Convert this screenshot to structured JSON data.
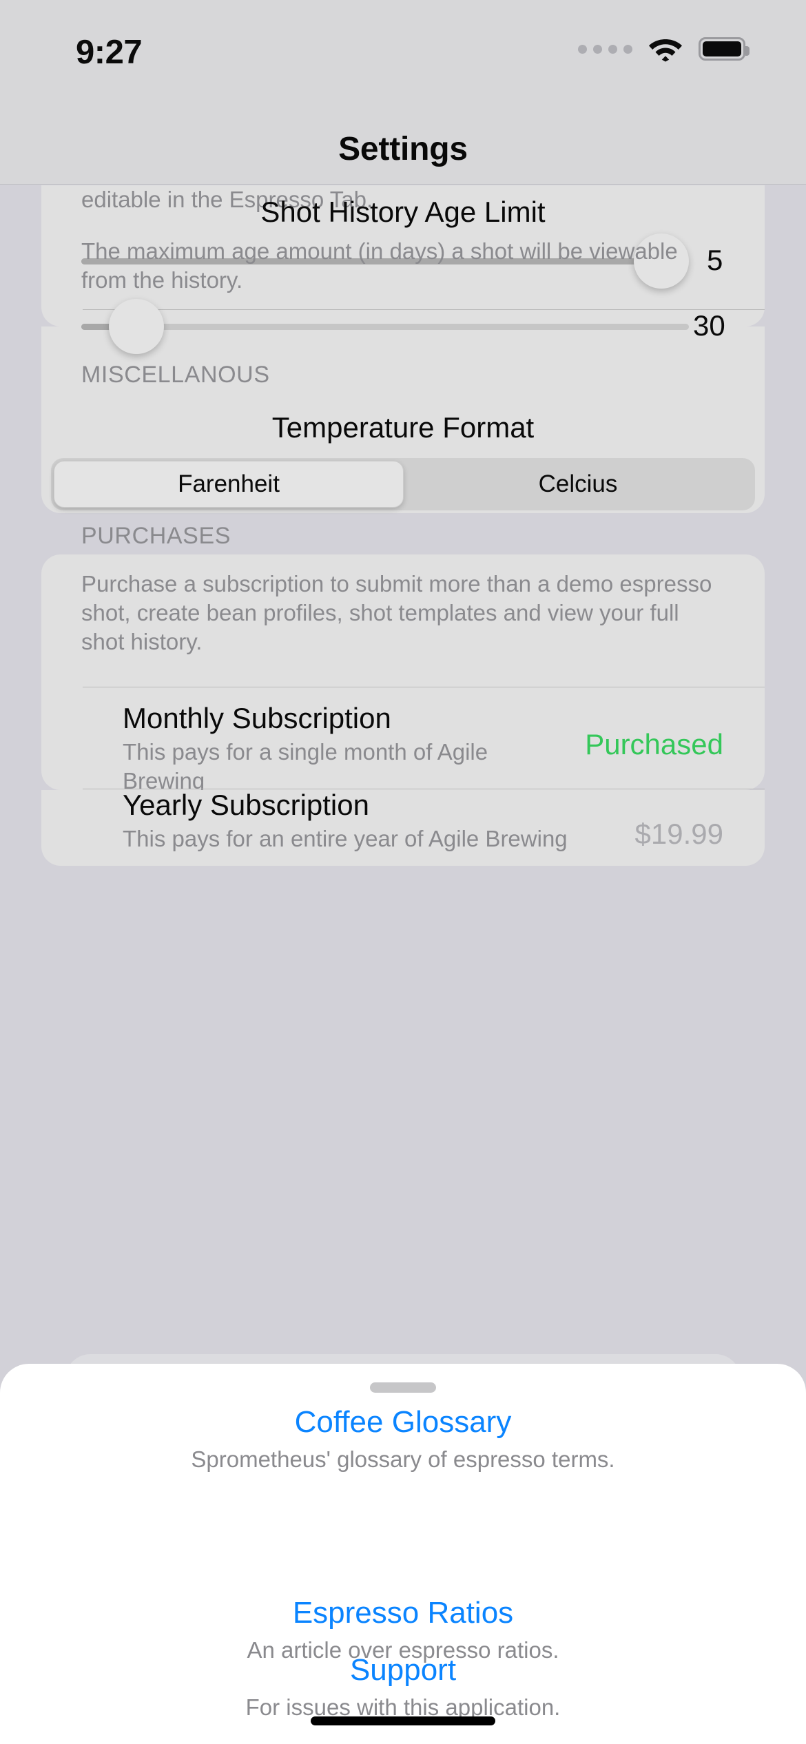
{
  "status_bar": {
    "time": "9:27",
    "cellular_icon": "signal-dots-icon",
    "wifi_icon": "wifi-icon",
    "battery_icon": "battery-full-icon"
  },
  "nav": {
    "title": "Settings"
  },
  "settings_section": {
    "truncated_description": "editable in the Espresso Tab.",
    "shot_count_slider": {
      "value": "5",
      "percent": 100
    },
    "shot_history": {
      "title": "Shot History Age Limit",
      "description": "The maximum age amount (in days) a shot will be viewable from the history.",
      "slider": {
        "value": "30",
        "percent": 9
      }
    }
  },
  "miscellanous": {
    "header": "MISCELLANOUS",
    "temperature_format": {
      "title": "Temperature Format",
      "options": [
        {
          "label": "Farenheit",
          "selected": true
        },
        {
          "label": "Celcius",
          "selected": false
        }
      ]
    }
  },
  "purchases": {
    "header": "PURCHASES",
    "description": "Purchase a subscription to submit more than a demo espresso shot, create bean profiles, shot templates and view your full shot history.",
    "items": [
      {
        "title": "Monthly Subscription",
        "subtitle": "This pays for a single month of Agile Brewing",
        "status": "Purchased",
        "status_color": "#34c759"
      },
      {
        "title": "Yearly Subscription",
        "subtitle": "This pays for an entire year of Agile Brewing",
        "status": "$19.99",
        "status_color": "#aaaaae"
      }
    ]
  },
  "sheet": {
    "grabber": "drag-handle",
    "links": [
      {
        "title": "Coffee Glossary",
        "subtitle": "Sprometheus' glossary of espresso terms."
      },
      {
        "title": "Espresso Ratios",
        "subtitle": "An article over espresso ratios."
      },
      {
        "title": "Support",
        "subtitle": "For issues with this application."
      }
    ]
  },
  "colors": {
    "link": "#0a84ff",
    "purchased": "#34c759",
    "page_bg": "#d2d1d8",
    "card_bg": "#e0e0e0"
  }
}
